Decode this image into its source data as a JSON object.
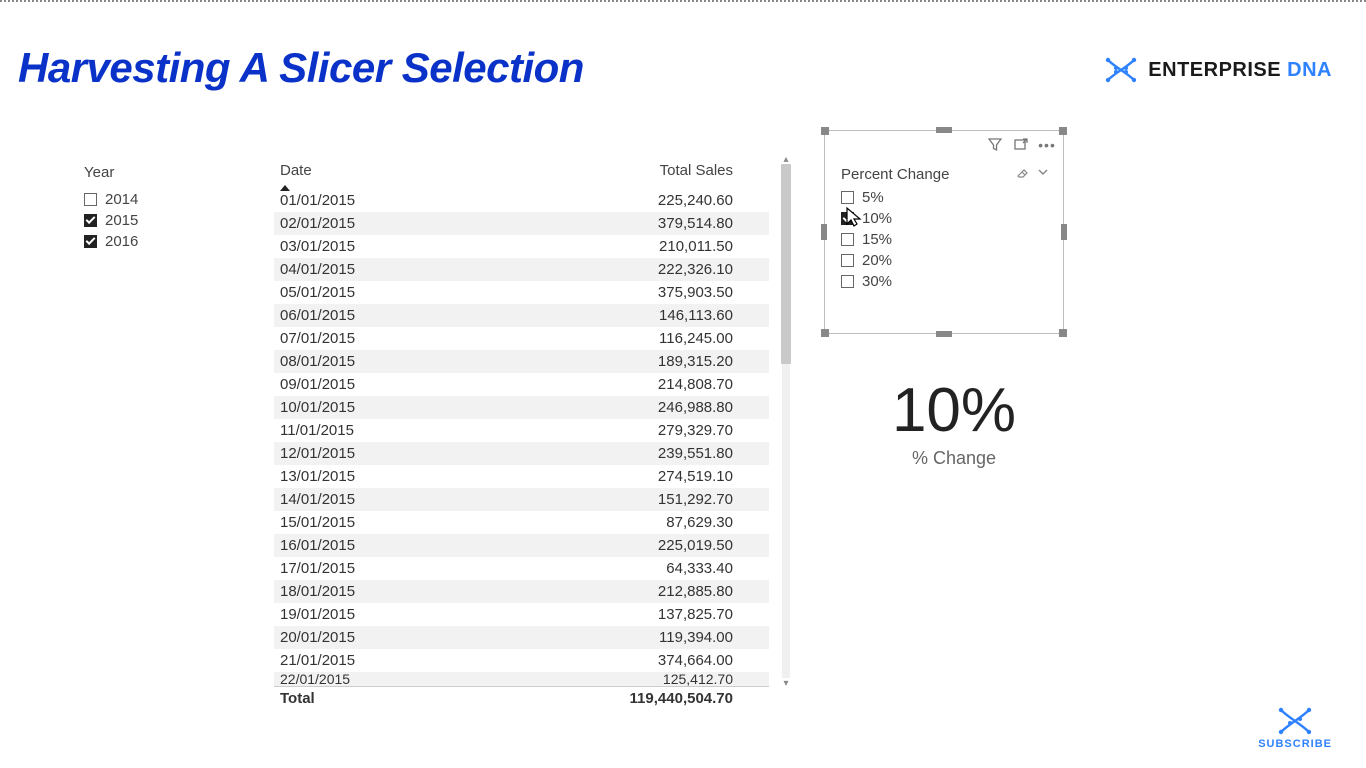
{
  "title": "Harvesting A Slicer Selection",
  "logo": {
    "text_enterprise": "ENTERPRISE ",
    "text_dna": "DNA"
  },
  "year_slicer": {
    "title": "Year",
    "items": [
      {
        "label": "2014",
        "checked": false
      },
      {
        "label": "2015",
        "checked": true
      },
      {
        "label": "2016",
        "checked": true
      }
    ]
  },
  "table": {
    "columns": {
      "date": "Date",
      "total_sales": "Total Sales"
    },
    "rows": [
      {
        "date": "01/01/2015",
        "value": "225,240.60"
      },
      {
        "date": "02/01/2015",
        "value": "379,514.80"
      },
      {
        "date": "03/01/2015",
        "value": "210,011.50"
      },
      {
        "date": "04/01/2015",
        "value": "222,326.10"
      },
      {
        "date": "05/01/2015",
        "value": "375,903.50"
      },
      {
        "date": "06/01/2015",
        "value": "146,113.60"
      },
      {
        "date": "07/01/2015",
        "value": "116,245.00"
      },
      {
        "date": "08/01/2015",
        "value": "189,315.20"
      },
      {
        "date": "09/01/2015",
        "value": "214,808.70"
      },
      {
        "date": "10/01/2015",
        "value": "246,988.80"
      },
      {
        "date": "11/01/2015",
        "value": "279,329.70"
      },
      {
        "date": "12/01/2015",
        "value": "239,551.80"
      },
      {
        "date": "13/01/2015",
        "value": "274,519.10"
      },
      {
        "date": "14/01/2015",
        "value": "151,292.70"
      },
      {
        "date": "15/01/2015",
        "value": "87,629.30"
      },
      {
        "date": "16/01/2015",
        "value": "225,019.50"
      },
      {
        "date": "17/01/2015",
        "value": "64,333.40"
      },
      {
        "date": "18/01/2015",
        "value": "212,885.80"
      },
      {
        "date": "19/01/2015",
        "value": "137,825.70"
      },
      {
        "date": "20/01/2015",
        "value": "119,394.00"
      },
      {
        "date": "21/01/2015",
        "value": "374,664.00"
      }
    ],
    "cutoff_row": {
      "date": "22/01/2015",
      "value": "125,412.70"
    },
    "total_label": "Total",
    "total_value": "119,440,504.70"
  },
  "percent_slicer": {
    "title": "Percent Change",
    "items": [
      {
        "label": "5%",
        "checked": false
      },
      {
        "label": "10%",
        "checked": true
      },
      {
        "label": "15%",
        "checked": false
      },
      {
        "label": "20%",
        "checked": false
      },
      {
        "label": "30%",
        "checked": false
      }
    ]
  },
  "card": {
    "value": "10%",
    "label": "% Change"
  },
  "subscribe": {
    "label": "SUBSCRIBE"
  }
}
